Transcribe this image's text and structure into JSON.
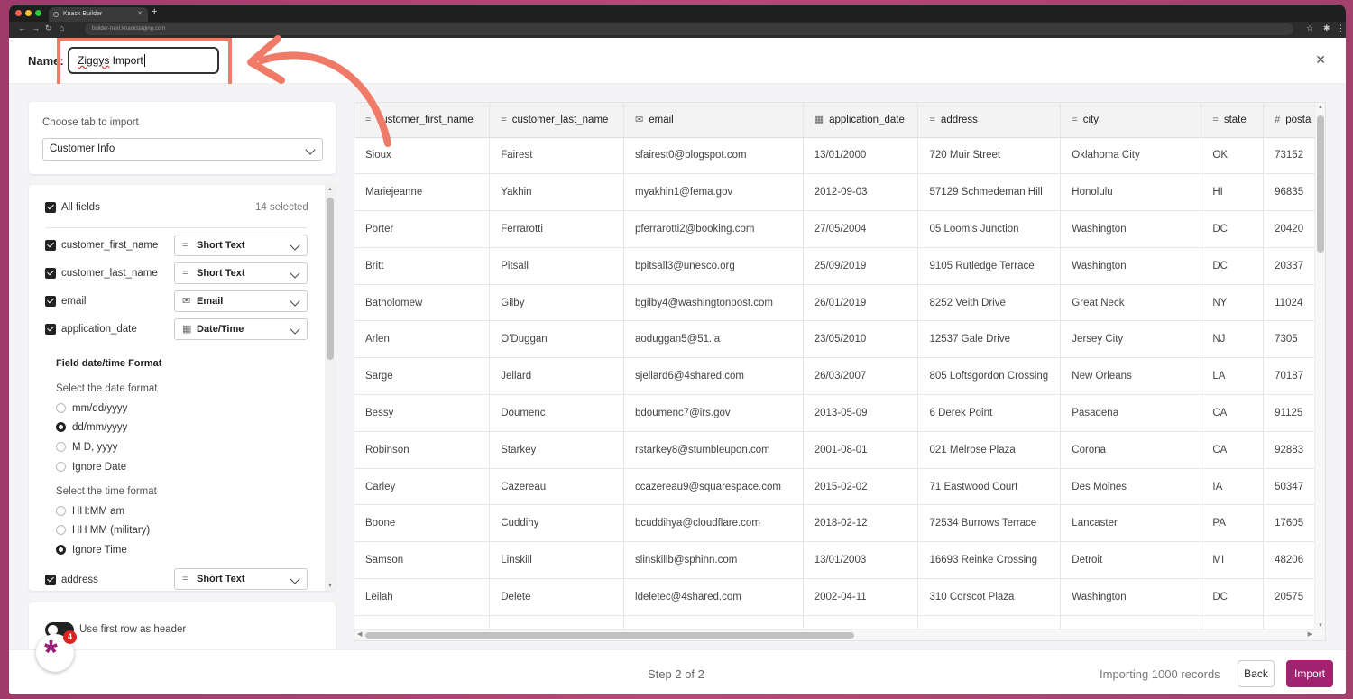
{
  "browser": {
    "tab_title": "Knack Builder",
    "url": "builder-next.knackstaging.com",
    "colors": {
      "close": "#ff5f57",
      "min": "#febc2e",
      "max": "#28c840"
    }
  },
  "header": {
    "name_label": "Name:",
    "name_value_misspelled": "Ziggys",
    "name_value_rest": " Import"
  },
  "tab_picker": {
    "label": "Choose tab to import",
    "selected": "Customer Info"
  },
  "fields": {
    "all_label": "All fields",
    "selected_count": "14 selected",
    "items": [
      {
        "name": "customer_first_name",
        "type": "Short Text",
        "icon": "equals-icon"
      },
      {
        "name": "customer_last_name",
        "type": "Short Text",
        "icon": "equals-icon"
      },
      {
        "name": "email",
        "type": "Email",
        "icon": "envelope-icon"
      },
      {
        "name": "application_date",
        "type": "Date/Time",
        "icon": "calendar-icon"
      }
    ],
    "date_time": {
      "title": "Field date/time Format",
      "date_label": "Select the date format",
      "date_options": [
        "mm/dd/yyyy",
        "dd/mm/yyyy",
        "M D, yyyy",
        "Ignore Date"
      ],
      "date_selected": "dd/mm/yyyy",
      "time_label": "Select the time format",
      "time_options": [
        "HH:MM am",
        "HH MM (military)",
        "Ignore Time"
      ],
      "time_selected": "Ignore Time"
    },
    "after": [
      {
        "name": "address",
        "type": "Short Text",
        "icon": "equals-icon"
      }
    ]
  },
  "header_toggle": {
    "label": "Use first row as header"
  },
  "notification_badge": {
    "count": "4"
  },
  "table": {
    "columns": [
      {
        "label": "customer_first_name",
        "icon": "="
      },
      {
        "label": "customer_last_name",
        "icon": "="
      },
      {
        "label": "email",
        "icon": "✉"
      },
      {
        "label": "application_date",
        "icon": "▦"
      },
      {
        "label": "address",
        "icon": "="
      },
      {
        "label": "city",
        "icon": "="
      },
      {
        "label": "state",
        "icon": "="
      },
      {
        "label": "posta",
        "icon": "#"
      }
    ],
    "rows": [
      [
        "Sioux",
        "Fairest",
        "sfairest0@blogspot.com",
        "13/01/2000",
        "720 Muir Street",
        "Oklahoma City",
        "OK",
        "73152"
      ],
      [
        "Mariejeanne",
        "Yakhin",
        "myakhin1@fema.gov",
        "2012-09-03",
        "57129 Schmedeman Hill",
        "Honolulu",
        "HI",
        "96835"
      ],
      [
        "Porter",
        "Ferrarotti",
        "pferrarotti2@booking.com",
        "27/05/2004",
        "05 Loomis Junction",
        "Washington",
        "DC",
        "20420"
      ],
      [
        "Britt",
        "Pitsall",
        "bpitsall3@unesco.org",
        "25/09/2019",
        "9105 Rutledge Terrace",
        "Washington",
        "DC",
        "20337"
      ],
      [
        "Batholomew",
        "Gilby",
        "bgilby4@washingtonpost.com",
        "26/01/2019",
        "8252 Veith Drive",
        "Great Neck",
        "NY",
        "11024"
      ],
      [
        "Arlen",
        "O'Duggan",
        "aoduggan5@51.la",
        "23/05/2010",
        "12537 Gale Drive",
        "Jersey City",
        "NJ",
        "7305"
      ],
      [
        "Sarge",
        "Jellard",
        "sjellard6@4shared.com",
        "26/03/2007",
        "805 Loftsgordon Crossing",
        "New Orleans",
        "LA",
        "70187"
      ],
      [
        "Bessy",
        "Doumenc",
        "bdoumenc7@irs.gov",
        "2013-05-09",
        "6 Derek Point",
        "Pasadena",
        "CA",
        "91125"
      ],
      [
        "Robinson",
        "Starkey",
        "rstarkey8@stumbleupon.com",
        "2001-08-01",
        "021 Melrose Plaza",
        "Corona",
        "CA",
        "92883"
      ],
      [
        "Carley",
        "Cazereau",
        "ccazereau9@squarespace.com",
        "2015-02-02",
        "71 Eastwood Court",
        "Des Moines",
        "IA",
        "50347"
      ],
      [
        "Boone",
        "Cuddihy",
        "bcuddihya@cloudflare.com",
        "2018-02-12",
        "72534 Burrows Terrace",
        "Lancaster",
        "PA",
        "17605"
      ],
      [
        "Samson",
        "Linskill",
        "slinskillb@sphinn.com",
        "13/01/2003",
        "16693 Reinke Crossing",
        "Detroit",
        "MI",
        "48206"
      ],
      [
        "Leilah",
        "Delete",
        "ldeletec@4shared.com",
        "2002-04-11",
        "310 Corscot Plaza",
        "Washington",
        "DC",
        "20575"
      ],
      [
        "",
        "",
        "",
        "",
        "",
        "",
        "",
        ""
      ]
    ]
  },
  "footer": {
    "step": "Step 2 of 2",
    "importing": "Importing 1000 records",
    "back_label": "Back",
    "import_label": "Import",
    "accent": "#a3226f"
  },
  "annotation": {
    "highlight_color": "#f07a68"
  }
}
